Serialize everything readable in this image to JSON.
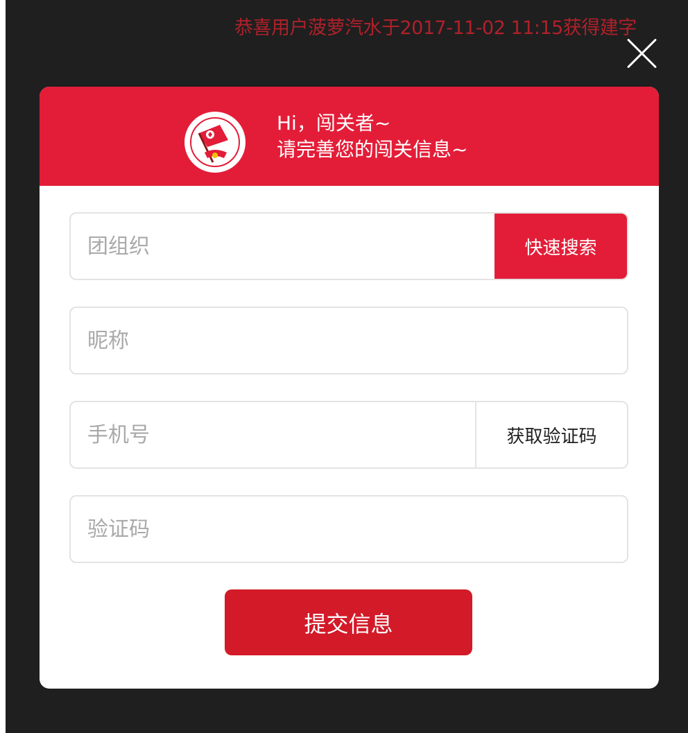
{
  "notification": {
    "text": "恭喜用户菠萝汽水于2017-11-02 11:15获得建字"
  },
  "close": {
    "icon": "close-icon"
  },
  "header": {
    "logo_icon": "league-emblem-icon",
    "greeting_line1": "Hi，闯关者~",
    "greeting_line2": "请完善您的闯关信息~"
  },
  "form": {
    "organization": {
      "placeholder": "团组织",
      "value": "",
      "search_label": "快速搜索"
    },
    "nickname": {
      "placeholder": "昵称",
      "value": ""
    },
    "phone": {
      "placeholder": "手机号",
      "value": "",
      "get_code_label": "获取验证码"
    },
    "code": {
      "placeholder": "验证码",
      "value": ""
    },
    "submit_label": "提交信息"
  },
  "colors": {
    "accent": "#e31d38",
    "submit": "#d21a28",
    "backdrop": "#1f1f1f"
  }
}
